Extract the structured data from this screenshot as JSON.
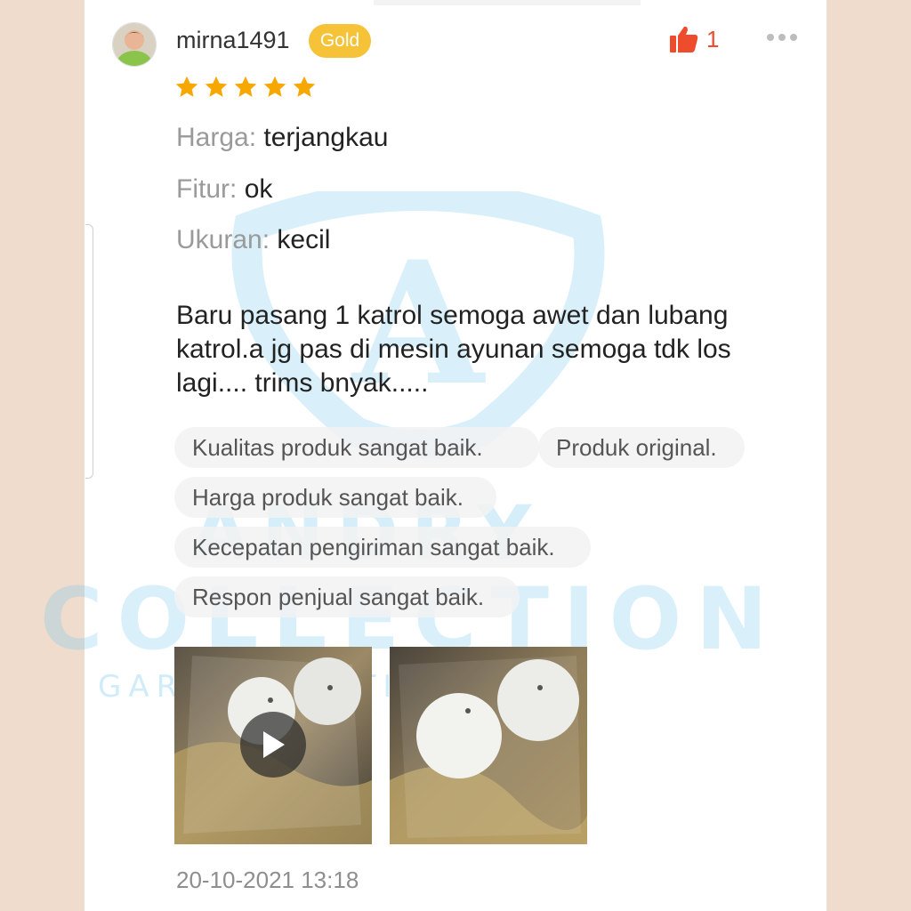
{
  "review": {
    "user": {
      "name": "mirna1491",
      "badge": "Gold"
    },
    "likes": "1",
    "rating": 5,
    "attributes": [
      {
        "key": "Harga:",
        "value": "terjangkau"
      },
      {
        "key": "Fitur:",
        "value": "ok"
      },
      {
        "key": "Ukuran:",
        "value": "kecil"
      }
    ],
    "text_lines": [
      "Baru pasang 1 katrol semoga awet dan lubang",
      "katrol.a jg pas di mesin ayunan semoga tdk los",
      "lagi.... trims bnyak....."
    ],
    "tags": [
      "Kualitas produk sangat baik.",
      "Produk original.",
      "Harga produk sangat baik.",
      "Kecepatan pengiriman sangat baik.",
      "Respon penjual sangat baik."
    ],
    "timestamp": "20-10-2021 13:18"
  },
  "watermark": {
    "shield_letter": "A",
    "line1": "ANDRY",
    "line2": "COLLECTION",
    "line3": "GARANSI ANTI DELAY"
  },
  "icons": {
    "like": "thumbs-up-icon",
    "more": "more-dots-icon",
    "star": "star-icon",
    "play": "play-icon"
  },
  "colors": {
    "accent": "#ee4d2d",
    "badge": "#f5c238",
    "star": "#f6a700",
    "watermark": "#78c8ec"
  }
}
